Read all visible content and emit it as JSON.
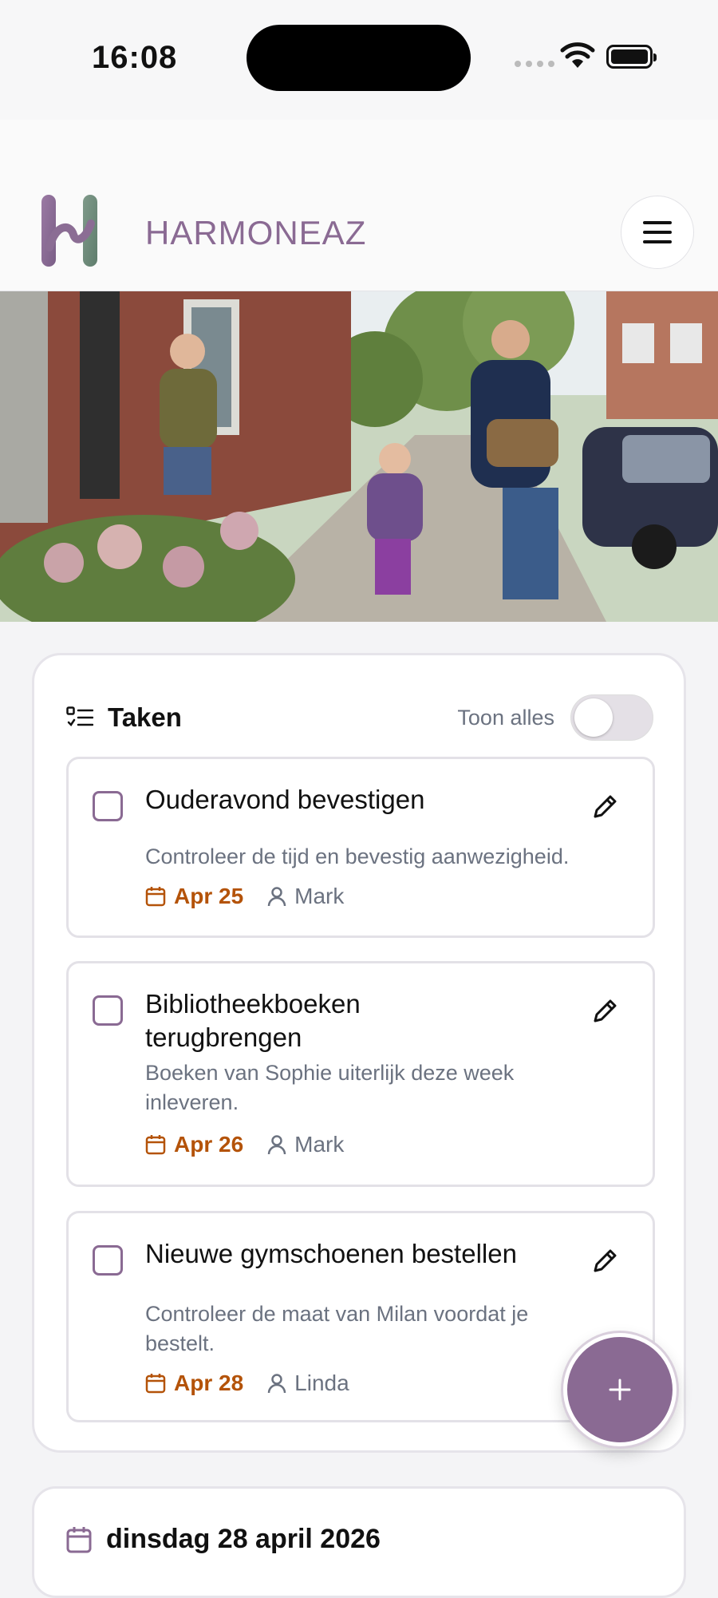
{
  "status_bar": {
    "time": "16:08"
  },
  "header": {
    "brand": "HARMONEAZ"
  },
  "tasks_card": {
    "title": "Taken",
    "toggle_label": "Toon alles",
    "toggle_on": false,
    "tasks": [
      {
        "title": "Ouderavond bevestigen",
        "description": "Controleer de tijd en bevestig aanwezigheid.",
        "date": "Apr 25",
        "assignee": "Mark"
      },
      {
        "title": "Bibliotheekboeken terugbrengen",
        "description": "Boeken van Sophie uiterlijk deze week inleveren.",
        "date": "Apr 26",
        "assignee": "Mark"
      },
      {
        "title": "Nieuwe gymschoenen bestellen",
        "description": "Controleer de maat van Milan voordat je bestelt.",
        "date": "Apr 28",
        "assignee": "Linda"
      }
    ]
  },
  "calendar_card": {
    "date_heading": "dinsdag 28 april 2026"
  },
  "colors": {
    "brand": "#8a6a93",
    "date_accent": "#b45309",
    "muted": "#6b7280"
  },
  "icons": {
    "logo": "harmoneaz-logo",
    "menu": "hamburger-menu-icon",
    "tasks": "checklist-icon",
    "edit": "pencil-icon",
    "date": "calendar-icon",
    "user": "person-icon",
    "add": "plus-icon"
  }
}
